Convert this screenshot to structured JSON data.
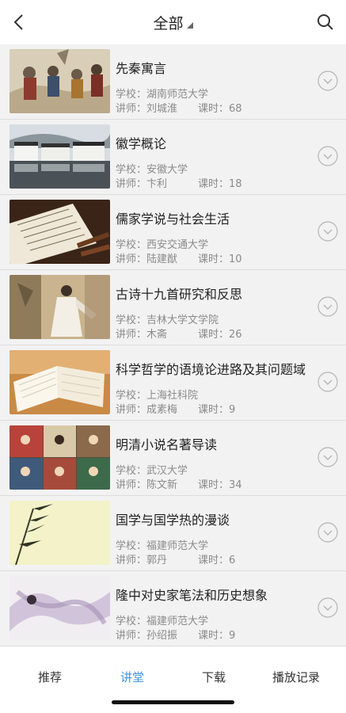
{
  "header": {
    "title": "全部",
    "back_icon": "chevron-left-icon",
    "search_icon": "search-icon",
    "dropdown_icon": "caret-down-icon"
  },
  "labels": {
    "school_prefix": "学校：",
    "teacher_prefix": "讲师：",
    "lesson_prefix": "课时："
  },
  "courses": [
    {
      "title": "先秦寓言",
      "school": "湖南师范大学",
      "teacher": "刘城淮",
      "lessons": "68",
      "thumb": "ancient-painting"
    },
    {
      "title": "徽学概论",
      "school": "安徽大学",
      "teacher": "卞利",
      "lessons": "18",
      "thumb": "hui-village"
    },
    {
      "title": "儒家学说与社会生活",
      "school": "西安交通大学",
      "teacher": "陆建猷",
      "lessons": "10",
      "thumb": "scroll-and-brush"
    },
    {
      "title": "古诗十九首研究和反思",
      "school": "吉林大学文学院",
      "teacher": "木斋",
      "lessons": "26",
      "thumb": "robed-figure"
    },
    {
      "title": "科学哲学的语境论进路及其问题域",
      "school": "上海社科院",
      "teacher": "成素梅",
      "lessons": "9",
      "thumb": "open-book"
    },
    {
      "title": "明清小说名著导读",
      "school": "武汉大学",
      "teacher": "陈文新",
      "lessons": "34",
      "thumb": "drama-stills"
    },
    {
      "title": "国学与国学热的漫谈",
      "school": "福建师范大学",
      "teacher": "郭丹",
      "lessons": "6",
      "thumb": "bamboo-ink"
    },
    {
      "title": "隆中对史家笔法和历史想象",
      "school": "福建师范大学",
      "teacher": "孙绍振",
      "lessons": "9",
      "thumb": "flowing-robe"
    }
  ],
  "tabs": [
    {
      "label": "推荐",
      "active": false
    },
    {
      "label": "讲堂",
      "active": true
    },
    {
      "label": "下载",
      "active": false
    },
    {
      "label": "播放记录",
      "active": false
    }
  ],
  "colors": {
    "accent": "#3e95e6",
    "list_background": "#f2f2f2",
    "meta_text": "#8a8a8a"
  }
}
